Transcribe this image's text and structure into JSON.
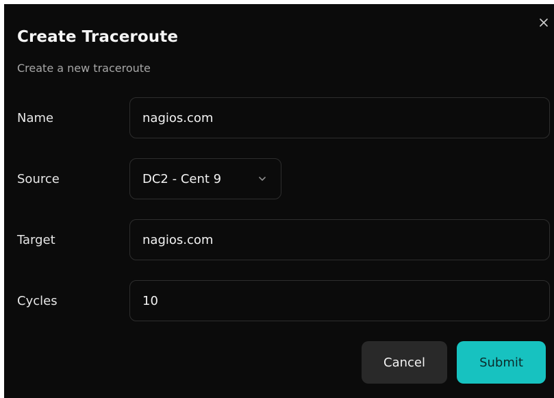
{
  "dialog": {
    "title": "Create Traceroute",
    "subtitle": "Create a new traceroute",
    "close_icon": "close-icon"
  },
  "form": {
    "name": {
      "label": "Name",
      "value": "nagios.com"
    },
    "source": {
      "label": "Source",
      "value": "DC2 - Cent 9",
      "icon": "chevron-down-icon"
    },
    "target": {
      "label": "Target",
      "value": "nagios.com"
    },
    "cycles": {
      "label": "Cycles",
      "value": "10"
    }
  },
  "actions": {
    "cancel_label": "Cancel",
    "submit_label": "Submit"
  },
  "colors": {
    "background": "#0b0b0b",
    "field_border": "#2e2e2e",
    "cancel_bg": "#292929",
    "submit_bg": "#17c2c0"
  }
}
